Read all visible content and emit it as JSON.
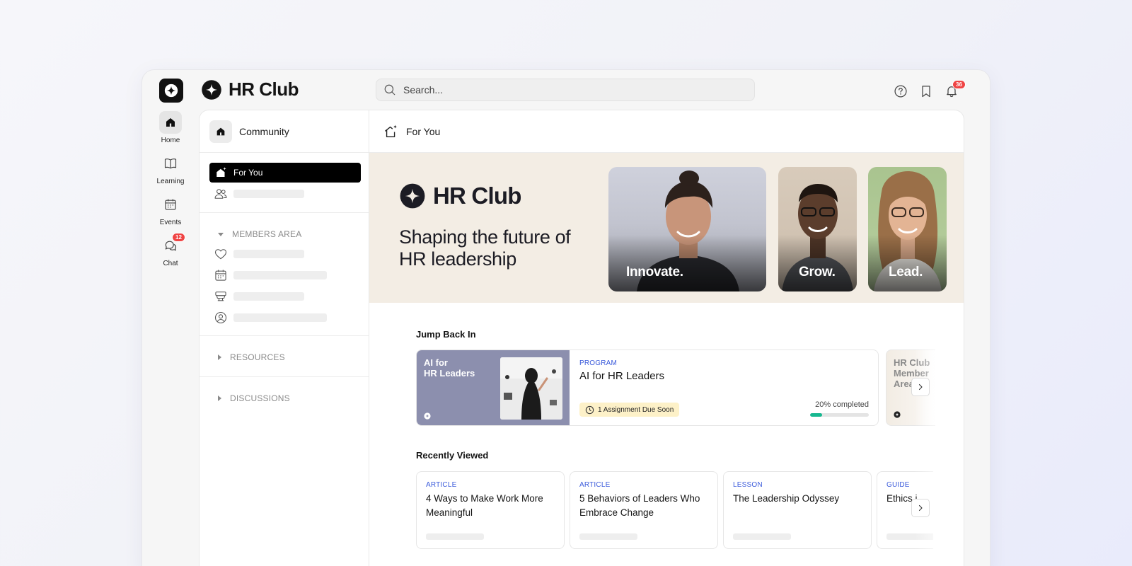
{
  "app": {
    "brand_name": "HR Club",
    "search_placeholder": "Search...",
    "notifications_count": "36"
  },
  "rail": {
    "items": [
      {
        "label": "Home",
        "icon": "home-icon",
        "active": true
      },
      {
        "label": "Learning",
        "icon": "book-icon",
        "active": false
      },
      {
        "label": "Events",
        "icon": "calendar-icon",
        "active": false
      },
      {
        "label": "Chat",
        "icon": "chat-icon",
        "active": false,
        "badge": "12"
      }
    ]
  },
  "sidebar": {
    "community_label": "Community",
    "for_you_label": "For You",
    "members_area_label": "MEMBERS AREA",
    "members_area_icons": [
      "heart-icon",
      "calendar-icon",
      "presentation-icon",
      "user-circle-icon"
    ],
    "resources_label": "RESOURCES",
    "discussions_label": "DISCUSSIONS"
  },
  "main": {
    "header_title": "For You",
    "hero": {
      "brand_name": "HR Club",
      "tagline": "Shaping the future of HR leadership",
      "cards": [
        {
          "label": "Innovate."
        },
        {
          "label": "Grow."
        },
        {
          "label": "Lead."
        }
      ]
    },
    "jump_back_in": {
      "title": "Jump Back In",
      "card": {
        "thumb_title_line1": "AI for",
        "thumb_title_line2": "HR Leaders",
        "eyebrow": "PROGRAM",
        "title": "AI for HR Leaders",
        "due_label": "1 Assignment Due Soon",
        "progress_label": "20% completed",
        "progress_value": 0.2
      },
      "peek_card": {
        "line1": "HR Club",
        "line2": "Member",
        "line3": "Area"
      }
    },
    "recently_viewed": {
      "title": "Recently Viewed",
      "items": [
        {
          "eyebrow": "ARTICLE",
          "title": "4 Ways to Make Work More Meaningful"
        },
        {
          "eyebrow": "ARTICLE",
          "title": "5 Behaviors of Leaders Who Embrace Change"
        },
        {
          "eyebrow": "LESSON",
          "title": "The Leadership Odyssey"
        },
        {
          "eyebrow": "GUIDE",
          "title": "Ethics i"
        }
      ]
    }
  },
  "colors": {
    "accent_blue": "#3b5bdb",
    "progress_green": "#17b890",
    "badge_red": "#ef4444",
    "hero_bg": "#f3ede4",
    "thumb_purple": "#8c8fae"
  }
}
